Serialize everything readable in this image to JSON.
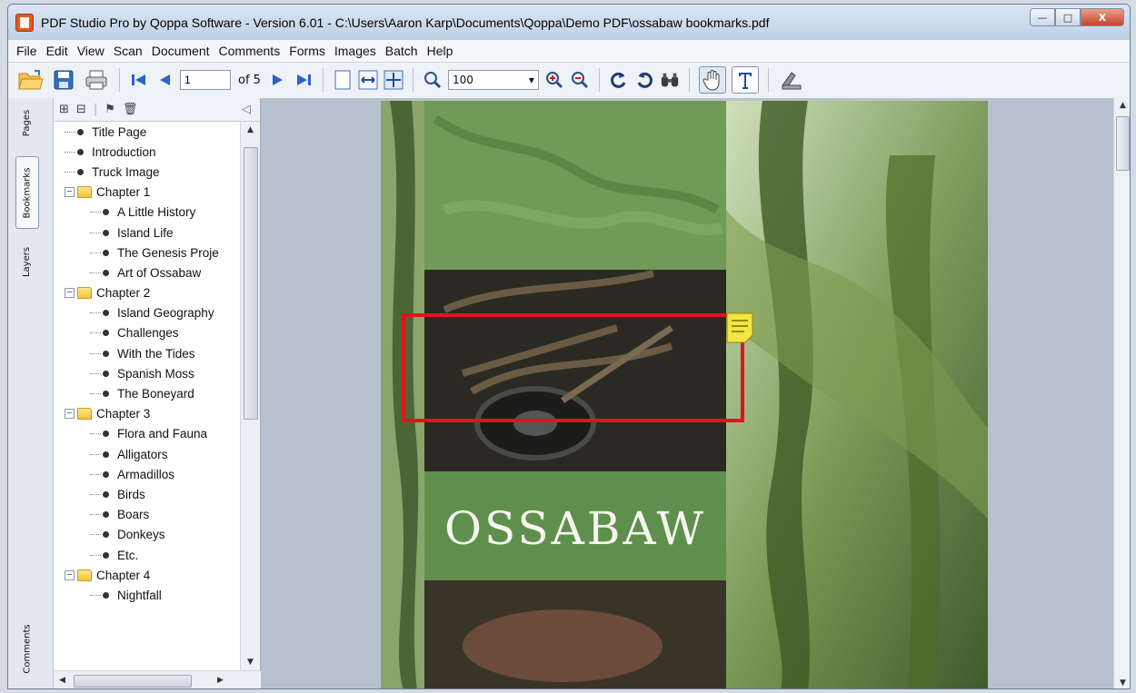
{
  "window": {
    "title": "PDF Studio Pro by Qoppa Software - Version 6.01 - C:\\Users\\Aaron Karp\\Documents\\Qoppa\\Demo PDF\\ossabaw bookmarks.pdf",
    "controls": {
      "minimize": "—",
      "maximize": "□",
      "close": "X"
    }
  },
  "menu": [
    "File",
    "Edit",
    "View",
    "Scan",
    "Document",
    "Comments",
    "Forms",
    "Images",
    "Batch",
    "Help"
  ],
  "toolbar": {
    "page_value": "1",
    "of_pages": "of 5",
    "zoom_value": "100"
  },
  "side_tabs": [
    "Pages",
    "Bookmarks",
    "Layers",
    "Comments"
  ],
  "bookmarks": [
    {
      "label": "Title Page",
      "level": 0,
      "kind": "item"
    },
    {
      "label": "Introduction",
      "level": 0,
      "kind": "item"
    },
    {
      "label": "Truck Image",
      "level": 0,
      "kind": "item"
    },
    {
      "label": "Chapter 1",
      "level": 0,
      "kind": "folder"
    },
    {
      "label": "A Little History",
      "level": 1,
      "kind": "item"
    },
    {
      "label": "Island Life",
      "level": 1,
      "kind": "item"
    },
    {
      "label": "The Genesis Proje",
      "level": 1,
      "kind": "item"
    },
    {
      "label": "Art of Ossabaw",
      "level": 1,
      "kind": "item"
    },
    {
      "label": "Chapter 2",
      "level": 0,
      "kind": "folder"
    },
    {
      "label": "Island Geography",
      "level": 1,
      "kind": "item"
    },
    {
      "label": "Challenges",
      "level": 1,
      "kind": "item"
    },
    {
      "label": "With the Tides",
      "level": 1,
      "kind": "item"
    },
    {
      "label": "Spanish Moss",
      "level": 1,
      "kind": "item"
    },
    {
      "label": "The Boneyard",
      "level": 1,
      "kind": "item"
    },
    {
      "label": "Chapter 3",
      "level": 0,
      "kind": "folder"
    },
    {
      "label": "Flora and Fauna",
      "level": 1,
      "kind": "item"
    },
    {
      "label": "Alligators",
      "level": 1,
      "kind": "item"
    },
    {
      "label": "Armadillos",
      "level": 1,
      "kind": "item"
    },
    {
      "label": "Birds",
      "level": 1,
      "kind": "item"
    },
    {
      "label": "Boars",
      "level": 1,
      "kind": "item"
    },
    {
      "label": "Donkeys",
      "level": 1,
      "kind": "item"
    },
    {
      "label": "Etc.",
      "level": 1,
      "kind": "item"
    },
    {
      "label": "Chapter 4",
      "level": 0,
      "kind": "folder"
    },
    {
      "label": "Nightfall",
      "level": 1,
      "kind": "item"
    }
  ],
  "document": {
    "cover_word": "OSSABAW",
    "annotation_color": "#e0141c",
    "note_color": "#f3e542"
  },
  "colors": {
    "accent": "#2a6fc9",
    "forest": "#4e7a3a",
    "panel_green": "#6d9a58"
  },
  "icons": {
    "row1": [
      "open-folder-icon",
      "save-icon",
      "print-icon",
      "first-page-icon",
      "prev-page-icon",
      "next-page-icon",
      "last-page-icon",
      "single-page-icon",
      "fit-width-icon",
      "fit-page-icon",
      "zoom-icon",
      "zoom-in-icon",
      "zoom-out-icon",
      "rotate-ccw-icon",
      "rotate-cw-icon",
      "find-icon",
      "hand-tool-icon",
      "text-select-icon",
      "stamp-icon"
    ],
    "row2": [
      "eraser-icon",
      "pen-check-icon",
      "check-icon",
      "box-pen-icon",
      "scissors-icon",
      "pencil-circle-icon",
      "pencil-icon",
      "page-lines-icon",
      "sticky-note-icon",
      "map-pin-icon",
      "pushpin-icon",
      "briefcase-icon",
      "paperclip-icon",
      "note-edit-icon",
      "attach-icon",
      "highlight-text-icon",
      "strikeout-text-icon",
      "underline-text-icon",
      "squiggly-text-icon",
      "area-highlight-icon",
      "line-tool-icon",
      "polygon-tool-icon",
      "polygon-fill-icon"
    ]
  }
}
